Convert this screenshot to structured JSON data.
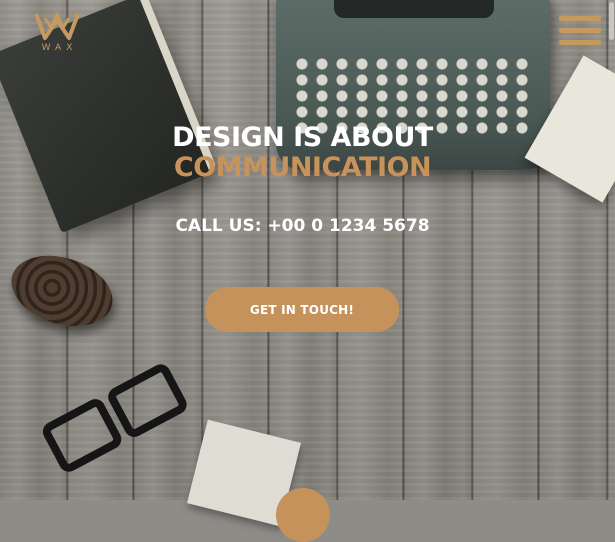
{
  "brand": {
    "logo_icon": "crown-w-logo-icon",
    "logo_text": "WAX",
    "accent_color": "#c4925a"
  },
  "header": {
    "menu_icon": "hamburger-menu-icon"
  },
  "hero": {
    "title_line_1": "DESIGN IS ABOUT",
    "title_line_2": "COMMUNICATION",
    "phone": "CALL US: +00 0 1234 5678",
    "cta_label": "GET IN TOUCH!",
    "scroll_icon": "scroll-down-icon"
  }
}
